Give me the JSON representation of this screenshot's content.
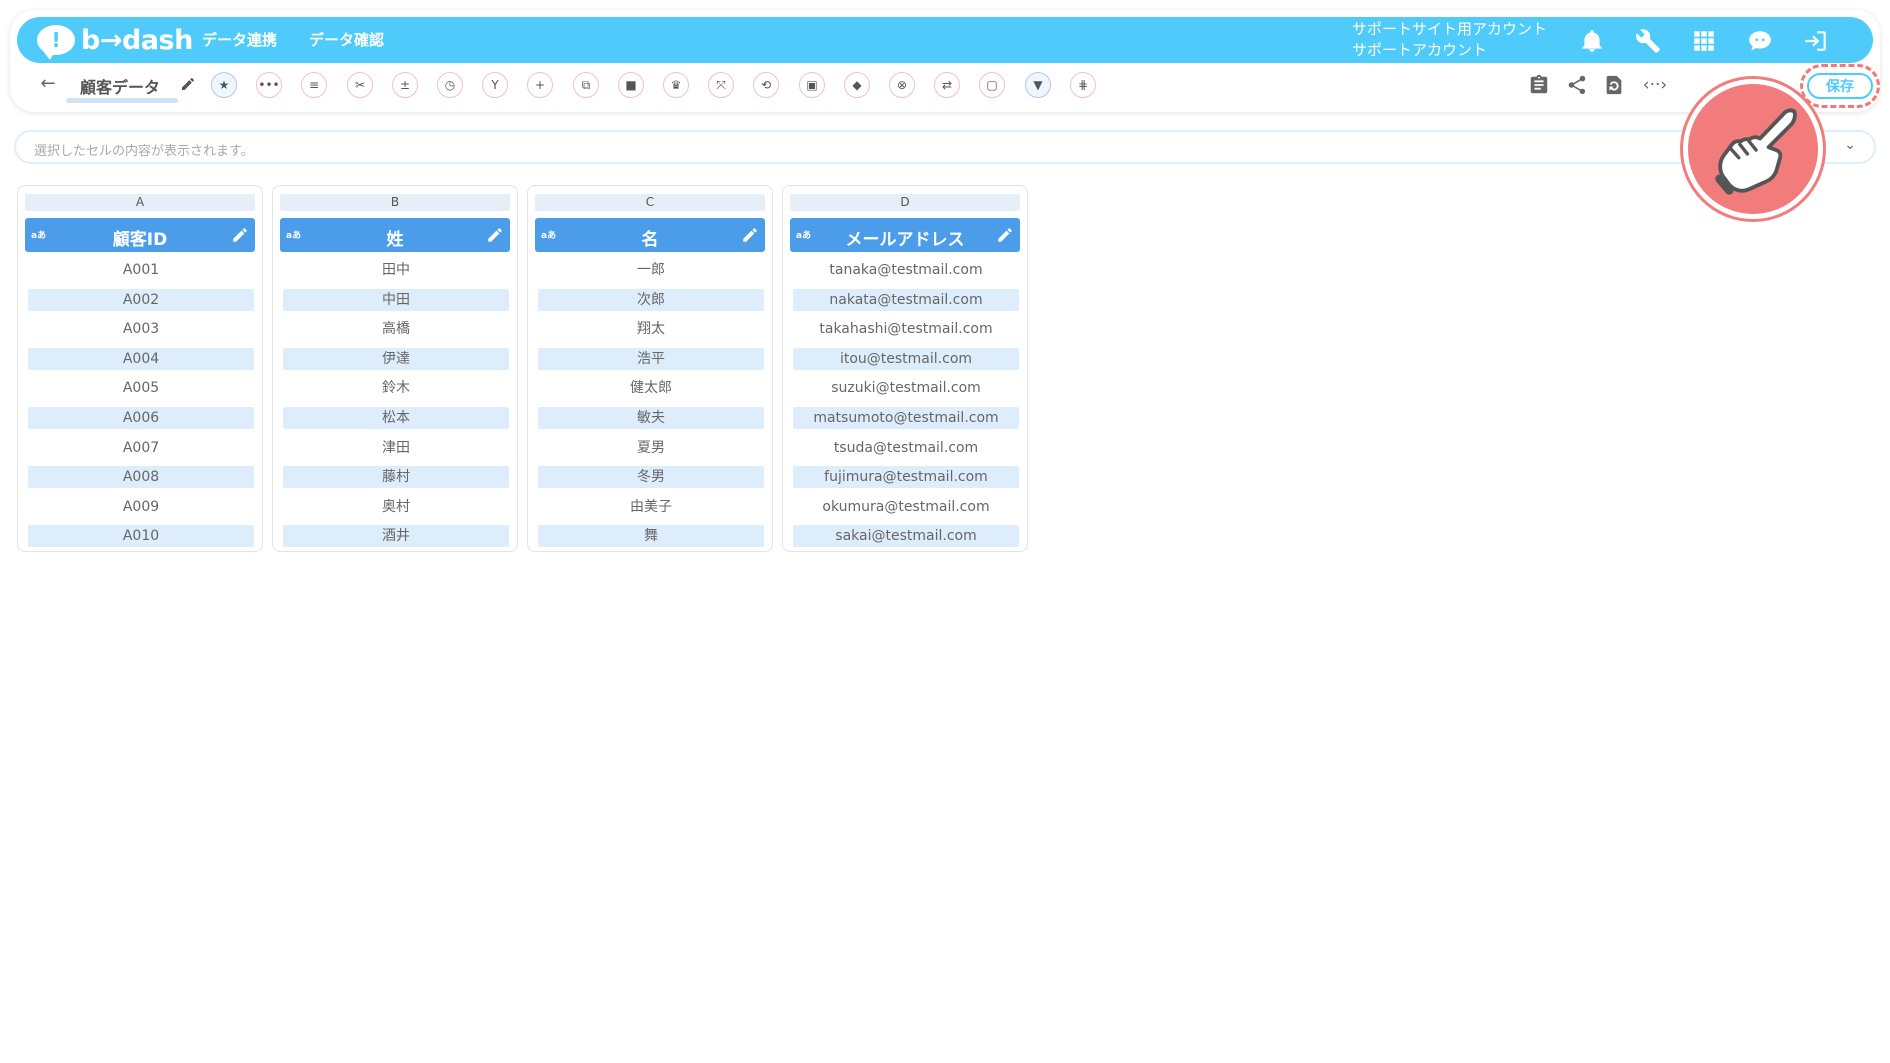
{
  "app": {
    "logo_text": "b→dash",
    "nav": [
      {
        "label": "データ連携"
      },
      {
        "label": "データ確認"
      }
    ],
    "account": {
      "line1": "サポートサイト用アカウント",
      "line2": "サポートアカウント"
    },
    "top_icons": [
      "bell-icon",
      "wrench-icon",
      "apps-grid-icon",
      "help-chat-icon",
      "logout-icon"
    ]
  },
  "toolbar": {
    "back_label": "←",
    "page_title": "顧客データ",
    "tools": [
      {
        "name": "favorite-tool",
        "glyph": "★",
        "active": true
      },
      {
        "name": "more-tool",
        "glyph": "•••"
      },
      {
        "name": "list-tool",
        "glyph": "≡"
      },
      {
        "name": "scissors-tool",
        "glyph": "✂"
      },
      {
        "name": "calc-tool",
        "glyph": "±"
      },
      {
        "name": "timer-tool",
        "glyph": "◷"
      },
      {
        "name": "merge-tool",
        "glyph": "Y"
      },
      {
        "name": "add-tool",
        "glyph": "+"
      },
      {
        "name": "copy-tool",
        "glyph": "⧉"
      },
      {
        "name": "delete-tool",
        "glyph": "■"
      },
      {
        "name": "crown-tool",
        "glyph": "♛"
      },
      {
        "name": "expand-tool",
        "glyph": "⤧"
      },
      {
        "name": "repeat-tool",
        "glyph": "⟲"
      },
      {
        "name": "lock-tool",
        "glyph": "▣"
      },
      {
        "name": "box-tool",
        "glyph": "◆"
      },
      {
        "name": "cancel-tool",
        "glyph": "⊗"
      },
      {
        "name": "convert-tool",
        "glyph": "⇄"
      },
      {
        "name": "frame-tool",
        "glyph": "▢"
      },
      {
        "name": "filter-tool",
        "glyph": "▼",
        "active": true
      },
      {
        "name": "grid-tool",
        "glyph": "⋕"
      }
    ],
    "right_tools": [
      "clipboard-icon",
      "share-icon",
      "refresh-icon",
      "code-icon"
    ],
    "save_label": "保存"
  },
  "cell_bar": {
    "placeholder": "選択したセルの内容が表示されます。"
  },
  "columns": [
    {
      "letter": "A",
      "type": "aあ",
      "name": "顧客ID",
      "cells": [
        "A001",
        "A002",
        "A003",
        "A004",
        "A005",
        "A006",
        "A007",
        "A008",
        "A009",
        "A010"
      ]
    },
    {
      "letter": "B",
      "type": "aあ",
      "name": "姓",
      "cells": [
        "田中",
        "中田",
        "高橋",
        "伊達",
        "鈴木",
        "松本",
        "津田",
        "藤村",
        "奥村",
        "酒井"
      ]
    },
    {
      "letter": "C",
      "type": "aあ",
      "name": "名",
      "cells": [
        "一郎",
        "次郎",
        "翔太",
        "浩平",
        "健太郎",
        "敏夫",
        "夏男",
        "冬男",
        "由美子",
        "舞"
      ]
    },
    {
      "letter": "D",
      "type": "aあ",
      "name": "メールアドレス",
      "cells": [
        "tanaka@testmail.com",
        "nakata@testmail.com",
        "takahashi@testmail.com",
        "itou@testmail.com",
        "suzuki@testmail.com",
        "matsumoto@testmail.com",
        "tsuda@testmail.com",
        "fujimura@testmail.com",
        "okumura@testmail.com",
        "sakai@testmail.com"
      ]
    }
  ],
  "colors": {
    "brand": "#4ecbfa",
    "header_blue": "#4b9dea",
    "stripe": "#deedfb",
    "highlight": "#f27b7b"
  }
}
